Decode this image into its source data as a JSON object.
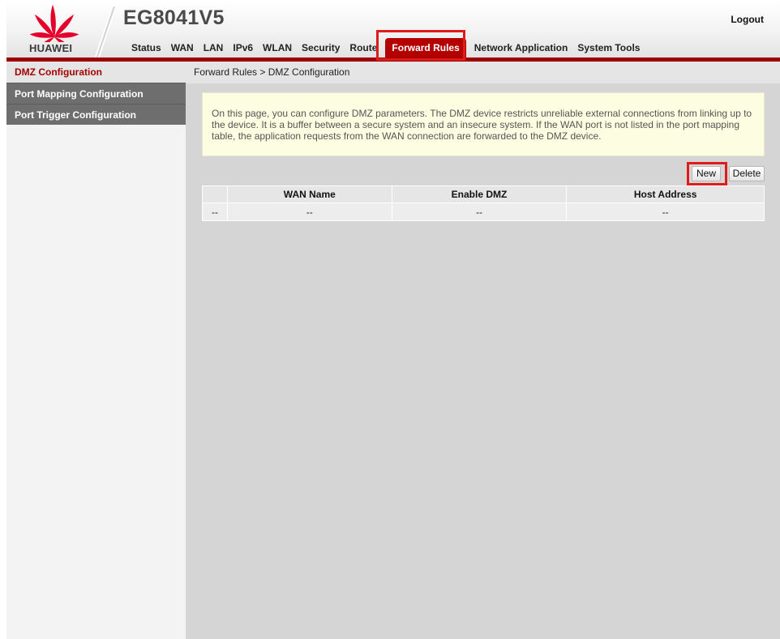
{
  "brand": {
    "logo_text": "HUAWEI",
    "logo_color": "#e4002b",
    "product_name": "EG8041V5",
    "accent_color": "#b40000"
  },
  "header": {
    "logout_label": "Logout"
  },
  "nav": {
    "items": [
      {
        "label": "Status"
      },
      {
        "label": "WAN"
      },
      {
        "label": "LAN"
      },
      {
        "label": "IPv6"
      },
      {
        "label": "WLAN"
      },
      {
        "label": "Security"
      },
      {
        "label": "Route"
      },
      {
        "label": "Forward Rules",
        "active": true
      },
      {
        "label": "Network Application"
      },
      {
        "label": "System Tools"
      }
    ]
  },
  "sidebar": {
    "items": [
      {
        "label": "DMZ Configuration",
        "active": true
      },
      {
        "label": "Port Mapping Configuration"
      },
      {
        "label": "Port Trigger Configuration"
      }
    ]
  },
  "main": {
    "breadcrumb": "Forward Rules > DMZ Configuration",
    "info_text": "On this page, you can configure DMZ parameters. The DMZ device restricts unreliable external connections from linking up to the device. It is a buffer between a secure system and an insecure system. If the WAN port is not listed in the port mapping table, the application requests from the WAN connection are forwarded to the DMZ device.",
    "new_label": "New",
    "delete_label": "Delete",
    "table": {
      "headers": [
        "",
        "WAN Name",
        "Enable DMZ",
        "Host Address"
      ],
      "rows": [
        [
          "--",
          "--",
          "--",
          "--"
        ]
      ]
    }
  },
  "highlight_color": "#e01b1b"
}
